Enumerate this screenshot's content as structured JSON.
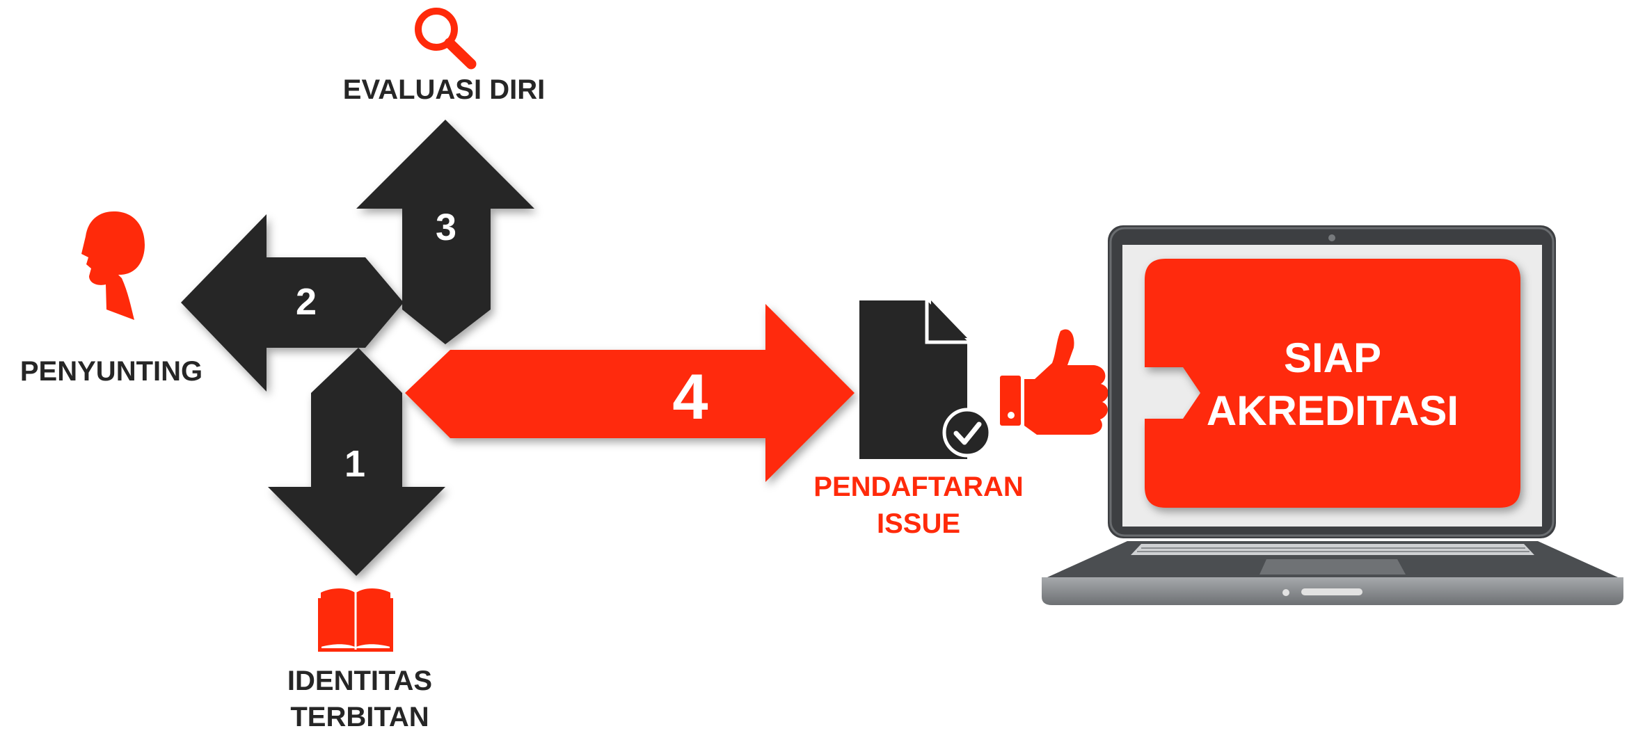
{
  "steps": [
    {
      "number": "1",
      "label_lines": [
        "IDENTITAS",
        "TERBITAN"
      ],
      "icon": "book-icon"
    },
    {
      "number": "2",
      "label_lines": [
        "PENYUNTING"
      ],
      "icon": "person-head-icon"
    },
    {
      "number": "3",
      "label_lines": [
        "EVALUASI DIRI"
      ],
      "icon": "magnifier-icon"
    },
    {
      "number": "4",
      "label_lines": [
        "PENDAFTARAN",
        "ISSUE"
      ],
      "icon": "document-check-icon"
    }
  ],
  "result": {
    "label_lines": [
      "SIAP",
      "AKREDITASI"
    ],
    "icons": [
      "thumbs-up-icon",
      "laptop-icon"
    ]
  },
  "colors": {
    "accent": "#ff2a0a",
    "dark": "#262626",
    "text_dark": "#262626",
    "laptop_body": "#8a8d90",
    "laptop_frame": "#3d3f42"
  }
}
